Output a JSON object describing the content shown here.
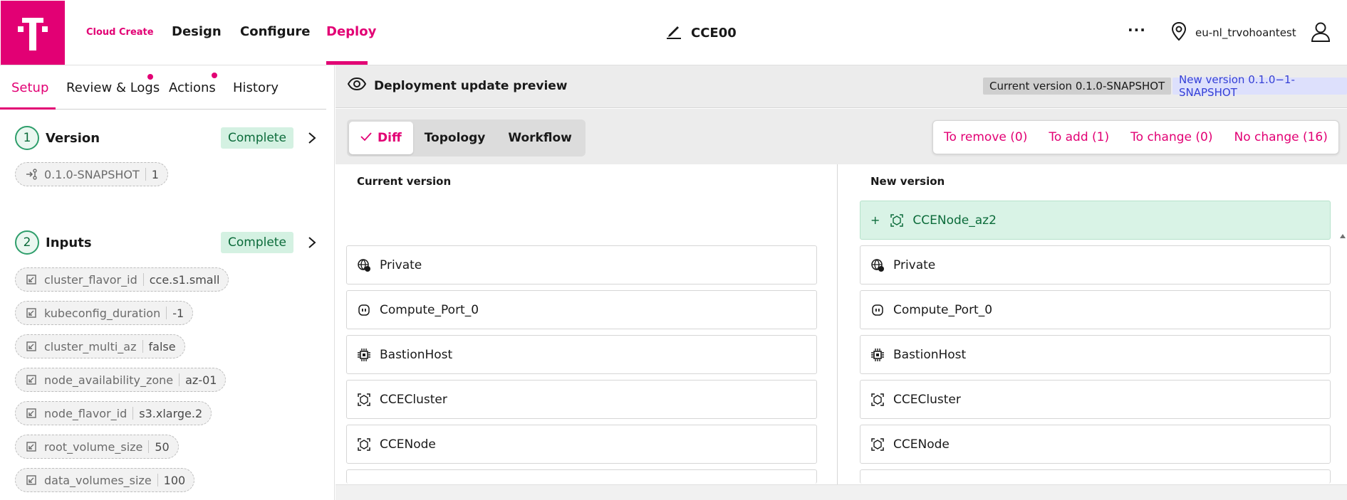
{
  "header": {
    "brand": "Cloud Create",
    "nav": [
      "Design",
      "Configure",
      "Deploy"
    ],
    "active_nav": "Deploy",
    "title": "CCE00",
    "location": "eu-nl_trvohoantest",
    "more": "···"
  },
  "left": {
    "tabs": [
      "Setup",
      "Review & Logs",
      "Actions",
      "History"
    ],
    "steps": [
      {
        "number": "1",
        "label": "Version",
        "status": "Complete"
      },
      {
        "number": "2",
        "label": "Inputs",
        "status": "Complete"
      }
    ],
    "version_pill": {
      "name": "0.1.0-SNAPSHOT",
      "value": "1"
    },
    "inputs": [
      {
        "name": "cluster_flavor_id",
        "value": "cce.s1.small"
      },
      {
        "name": "kubeconfig_duration",
        "value": "-1"
      },
      {
        "name": "cluster_multi_az",
        "value": "false"
      },
      {
        "name": "node_availability_zone",
        "value": "az-01"
      },
      {
        "name": "node_flavor_id",
        "value": "s3.xlarge.2"
      },
      {
        "name": "root_volume_size",
        "value": "50"
      },
      {
        "name": "data_volumes_size",
        "value": "100"
      }
    ]
  },
  "preview": {
    "title": "Deployment update preview",
    "current_version": "Current version 0.1.0-SNAPSHOT",
    "new_version": "New version 0.1.0−1-SNAPSHOT",
    "view_tabs": [
      "Diff",
      "Topology",
      "Workflow"
    ],
    "filters": [
      "To remove (0)",
      "To add (1)",
      "To change (0)",
      "No change (16)"
    ],
    "current_header": "Current version",
    "new_header": "New version",
    "added_item": {
      "marker": "+",
      "label": "CCENode_az2",
      "icon": "cluster-icon"
    },
    "items": [
      {
        "label": "Private",
        "icon": "network-icon"
      },
      {
        "label": "Compute_Port_0",
        "icon": "port-icon"
      },
      {
        "label": "BastionHost",
        "icon": "chip-icon"
      },
      {
        "label": "CCECluster",
        "icon": "cluster-icon"
      },
      {
        "label": "CCENode",
        "icon": "cluster-icon"
      }
    ]
  },
  "colors": {
    "brand": "#e20074",
    "complete_bg": "#d4f1e2",
    "added_bg": "#d9f3e6",
    "new_version_bg": "#dde0fc"
  }
}
